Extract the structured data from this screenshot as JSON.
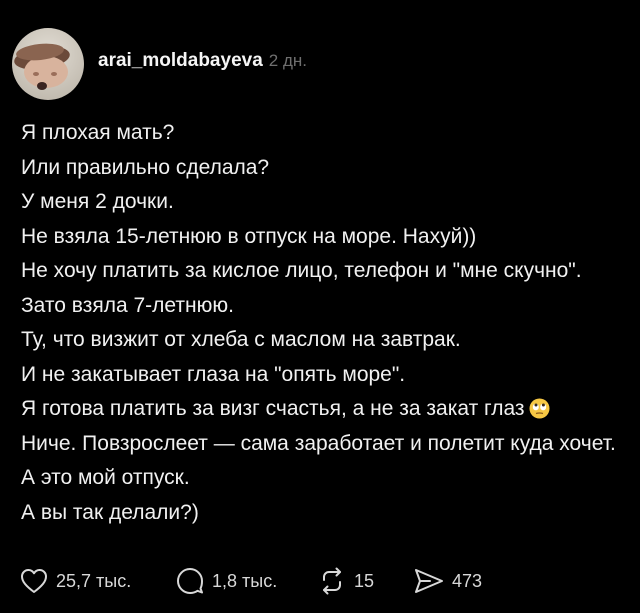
{
  "header": {
    "username": "arai_moldabayeva",
    "time": "2 дн."
  },
  "post": {
    "lines": [
      "Я плохая мать?",
      "Или правильно сделала?",
      "У меня 2 дочки.",
      "Не взяла 15-летнюю в отпуск на море. Нахуй))",
      "Не хочу платить за кислое лицо, телефон и \"мне скучно\".",
      "Зато взяла 7-летнюю.",
      "Ту, что визжит от хлеба с маслом на завтрак.",
      "И не закатывает глаза на \"опять море\".",
      "Я готова платить за визг счастья, а не за закат глаз",
      "Ниче. Повзрослеет — сама заработает и полетит куда хочет.",
      "А это мой отпуск.",
      "А вы так делали?)"
    ],
    "emoji": "eye-roll-emoji"
  },
  "actions": {
    "likes": "25,7 тыс.",
    "replies": "1,8 тыс.",
    "reposts": "15",
    "shares": "473"
  },
  "icons": {
    "like": "heart-icon",
    "reply": "speech-bubble-icon",
    "repost": "repost-icon",
    "share": "send-icon"
  },
  "colors": {
    "background": "#000000",
    "text": "#f1f1f1",
    "muted": "#6f6f6f"
  }
}
